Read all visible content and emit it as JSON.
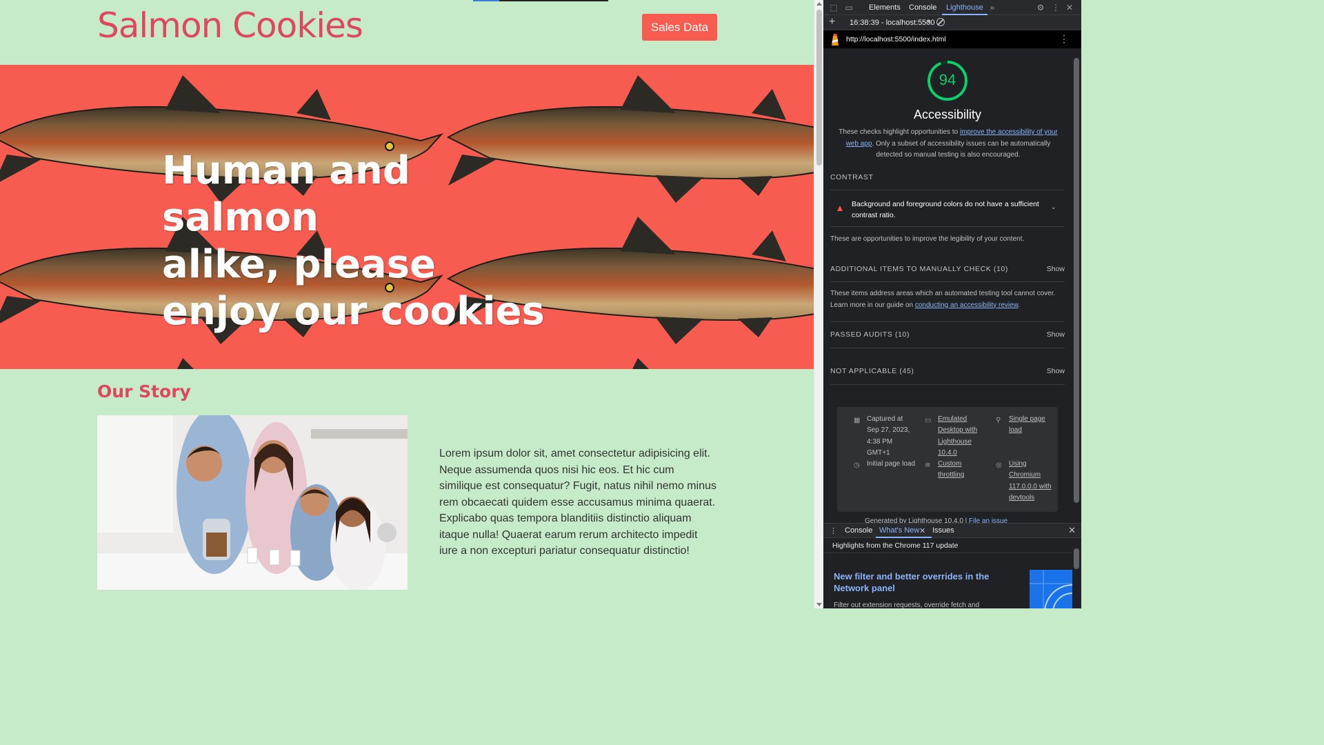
{
  "site": {
    "title": "Salmon Cookies",
    "nav_button": "Sales Data",
    "hero_headline_lines": [
      "Human and salmon",
      "alike, please",
      "enjoy our cookies"
    ],
    "story_title": "Our Story",
    "story_text": "Lorem ipsum dolor sit, amet consectetur adipisicing elit. Neque assumenda quos nisi hic eos. Et hic cum similique est consequatur? Fugit, natus nihil nemo minus rem obcaecati quidem esse accusamus minima quaerat. Explicabo quas tempora blanditiis distinctio aliquam itaque nulla! Quaerat earum rerum architecto impedit iure a non excepturi pariatur consequatur distinctio!",
    "colors": {
      "background": "#c6ebc9",
      "brand": "#e0475f",
      "hero": "#f85c50"
    }
  },
  "devtools": {
    "tabs": [
      "Elements",
      "Console",
      "Lighthouse"
    ],
    "active_tab": "Lighthouse",
    "session": "16:38:39 - localhost:5500",
    "report_url": "http://localhost:5500/index.html",
    "lighthouse": {
      "score": 94,
      "category": "Accessibility",
      "description_before": "These checks highlight opportunities to ",
      "description_link": "improve the accessibility of your web app",
      "description_after": ". Only a subset of accessibility issues can be automatically detected so manual testing is also encouraged.",
      "groups": {
        "contrast": "CONTRAST",
        "manual": "ADDITIONAL ITEMS TO MANUALLY CHECK (10)",
        "passed": "PASSED AUDITS (10)",
        "not_applicable": "NOT APPLICABLE (45)"
      },
      "show_label": "Show",
      "failed_audit": "Background and foreground colors do not have a sufficient contrast ratio.",
      "contrast_note": "These are opportunities to improve the legibility of your content.",
      "manual_note_before": "These items address areas which an automated testing tool cannot cover. Learn more in our guide on ",
      "manual_note_link": "conducting an accessibility review",
      "manual_note_after": ".",
      "meta": {
        "captured": "Captured at Sep 27, 2023, 4:38 PM GMT+1",
        "device": "Emulated Desktop with Lighthouse 10.4.0",
        "mode": "Single page load",
        "load": "Initial page load",
        "throttling": "Custom throttling",
        "browser": "Using Chromium 117.0.0.0 with devtools"
      },
      "footer_text": "Generated by Lighthouse 10.4.0 | ",
      "footer_link": "File an issue"
    },
    "drawer": {
      "tabs": [
        "Console",
        "What's New",
        "Issues"
      ],
      "active_tab": "What's New",
      "subtitle": "Highlights from the Chrome 117 update",
      "headline": "New filter and better overrides in the Network panel",
      "body": "Filter out extension requests, override fetch and"
    },
    "colors": {
      "accent": "#8ab4f8",
      "pass": "#0cce6b",
      "fail": "#ff4e42"
    }
  }
}
